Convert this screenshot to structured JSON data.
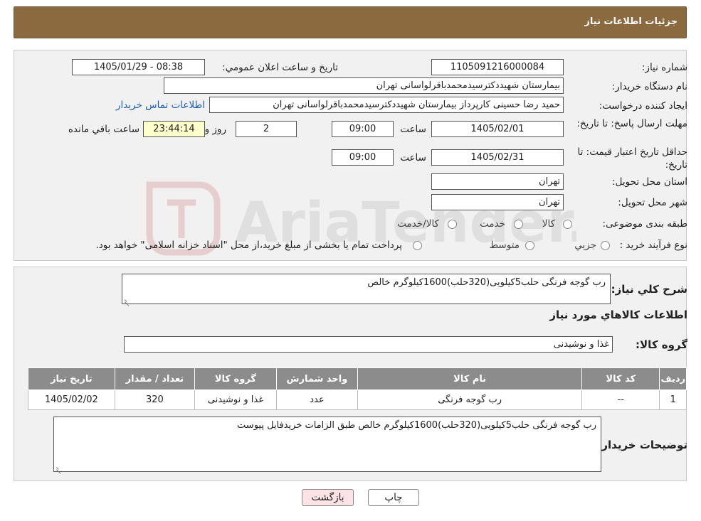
{
  "header": {
    "title": "جزئیات اطلاعات نیاز"
  },
  "watermark": {
    "text": "AriaTender.neT"
  },
  "fields": {
    "need_number_label": "شماره نیاز:",
    "need_number": "1105091216000084",
    "announce_label": "تاریخ و ساعت اعلان عمومي:",
    "announce_value": "1405/01/29 - 08:38",
    "buyer_org_label": "نام دستگاه خریدار:",
    "buyer_org": "بیمارستان شهیددکترسیدمحمدباقرلواسانی تهران",
    "creator_label": "ایجاد کننده درخواست:",
    "creator": "حمید رضا  حسینی کارپرداز بیمارستان شهیددکترسیدمحمدباقرلواسانی تهران",
    "contact_link": "اطلاعات تماس خریدار",
    "deadline_label": "مهلت ارسال پاسخ: تا تاریخ:",
    "deadline_date": "1405/02/01",
    "time_label": "ساعت",
    "deadline_time": "09:00",
    "days_value": "2",
    "days_label": "روز و",
    "remaining_time": "23:44:14",
    "remaining_label": "ساعت باقي مانده",
    "validity_label": "حداقل تاریخ اعتبار قیمت: تا تاریخ:",
    "validity_date": "1405/02/31",
    "validity_time_label": "ساعت",
    "validity_time": "09:00",
    "province_label": "استان محل تحویل:",
    "province": "تهران",
    "city_label": "شهر محل تحویل:",
    "city": "تهران",
    "category_label": "طبقه بندی موضوعی:",
    "category_options": [
      "کالا",
      "خدمت",
      "کالا/خدمت"
    ],
    "purchase_type_label": "نوع فرآیند خرید :",
    "purchase_options": [
      "جزیي",
      "متوسط"
    ],
    "purchase_note": "پرداخت تمام یا بخشی از مبلغ خرید،از محل \"اسناد خزانه اسلامی\" خواهد بود."
  },
  "description": {
    "label": "شرح کلي نیاز:",
    "value": "رب گوجه فرنگی حلب5کیلویی(320حلب)1600کیلوگرم خالص"
  },
  "goods_info": {
    "title": "اطلاعات کالاهاي مورد نیاز"
  },
  "goods_group": {
    "label": "گروه کالا:",
    "value": "غذا و نوشیدنی"
  },
  "table": {
    "headers": [
      "ردیف",
      "کد کالا",
      "نام کالا",
      "واحد شمارش",
      "گروه کالا",
      "تعداد / مقدار",
      "تاریخ نیاز"
    ],
    "rows": [
      [
        "1",
        "--",
        "رب گوجه فرنگی",
        "عدد",
        "غذا و نوشیدنی",
        "320",
        "1405/02/02"
      ]
    ]
  },
  "buyer_notes": {
    "label": "توضیحات خریدار:",
    "value": "رب گوجه فرنگی حلب5کیلویی(320حلب)1600کیلوگرم خالص طبق الزامات خریدفایل پیوست"
  },
  "buttons": {
    "print": "چاپ",
    "back": "بازگشت"
  }
}
